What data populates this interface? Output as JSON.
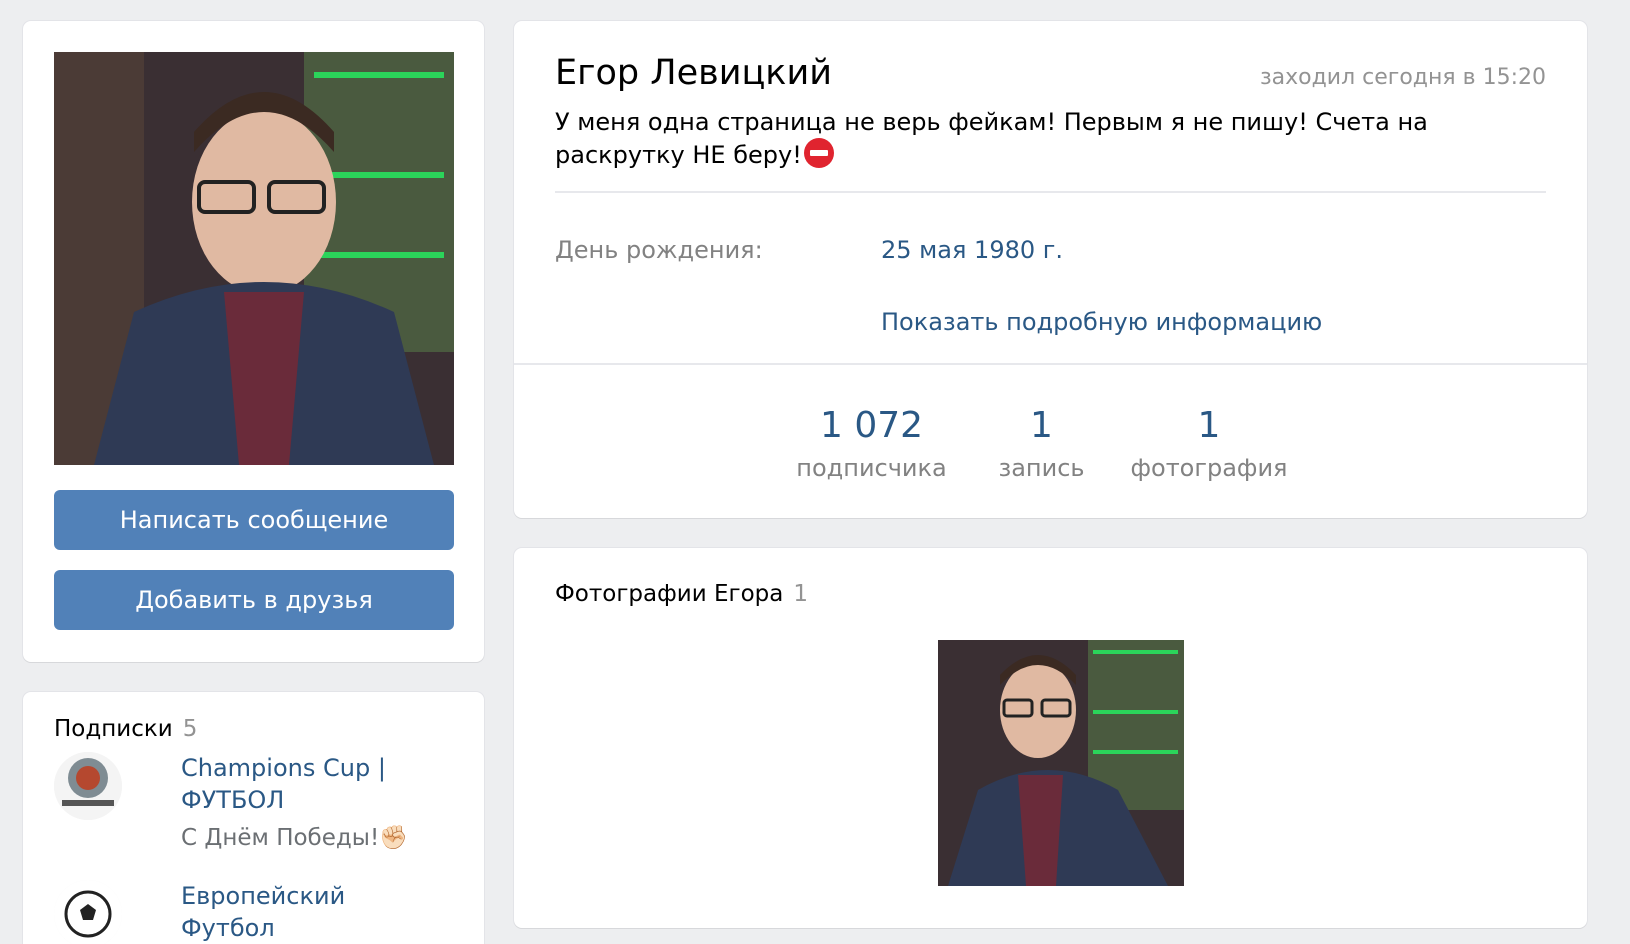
{
  "profile": {
    "name": "Егор Левицкий",
    "online": "заходил сегодня в 15:20",
    "status": "У меня одна страница не верь фейкам! Первым я не пишу! Счета на раскрутку НЕ беру!",
    "birthday_label": "День рождения:",
    "birthday_value": "25 мая 1980 г.",
    "more_info": "Показать подробную информацию"
  },
  "actions": {
    "message": "Написать сообщение",
    "add_friend": "Добавить в друзья"
  },
  "counters": [
    {
      "num": "1 072",
      "label": "подписчика"
    },
    {
      "num": "1",
      "label": "запись"
    },
    {
      "num": "1",
      "label": "фотография"
    }
  ],
  "photos": {
    "title": "Фотографии Егора",
    "count": "1"
  },
  "subscriptions": {
    "title": "Подписки",
    "count": "5",
    "items": [
      {
        "name": "Champions Cup | ФУТБОЛ",
        "status": "С Днём Победы!✊🏻"
      },
      {
        "name": "Европейский Футбол",
        "status": ""
      }
    ]
  },
  "colors": {
    "link": "#2a5885",
    "button": "#5181b8",
    "background": "#edeef0"
  }
}
